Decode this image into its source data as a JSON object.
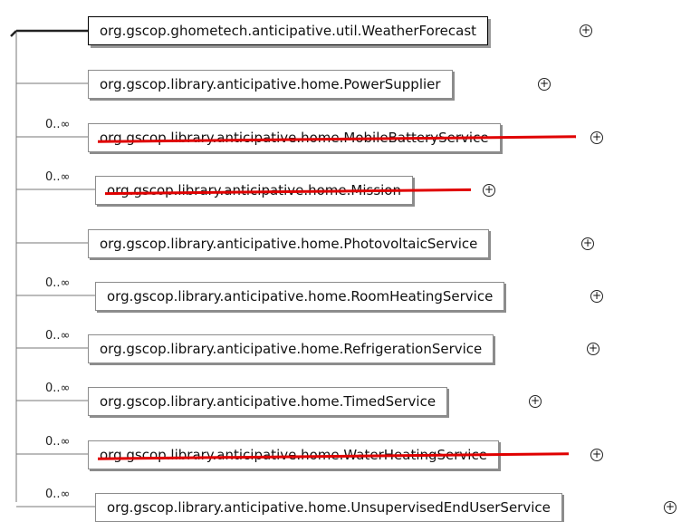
{
  "root": {
    "label": "org.gscop.ghometech.anticipative.util.WeatherForecast",
    "expand": "+"
  },
  "children": [
    {
      "label": "org.gscop.library.anticipative.home.PowerSupplier",
      "multiplicity": "",
      "struck": false,
      "expand": "+"
    },
    {
      "label": "org.gscop.library.anticipative.home.MobileBatteryService",
      "multiplicity": "0..∞",
      "struck": true,
      "expand": "+"
    },
    {
      "label": "org.gscop.library.anticipative.home.Mission",
      "multiplicity": "0..∞",
      "struck": true,
      "expand": "+"
    },
    {
      "label": "org.gscop.library.anticipative.home.PhotovoltaicService",
      "multiplicity": "",
      "struck": false,
      "expand": "+"
    },
    {
      "label": "org.gscop.library.anticipative.home.RoomHeatingService",
      "multiplicity": "0..∞",
      "struck": false,
      "expand": "+"
    },
    {
      "label": "org.gscop.library.anticipative.home.RefrigerationService",
      "multiplicity": "0..∞",
      "struck": false,
      "expand": "+"
    },
    {
      "label": "org.gscop.library.anticipative.home.TimedService",
      "multiplicity": "0..∞",
      "struck": false,
      "expand": "+"
    },
    {
      "label": "org.gscop.library.anticipative.home.WaterHeatingService",
      "multiplicity": "0..∞",
      "struck": true,
      "expand": "+"
    },
    {
      "label": "org.gscop.library.anticipative.home.UnsupervisedEndUserService",
      "multiplicity": "0..∞",
      "struck": false,
      "expand": "+"
    }
  ],
  "colors": {
    "strike": "#e00000",
    "connector": "#777777",
    "root_border": "#000000"
  }
}
